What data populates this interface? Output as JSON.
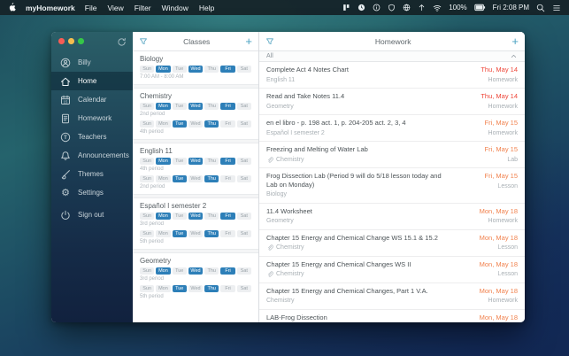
{
  "menu_bar": {
    "app_name": "myHomework",
    "menus": [
      "File",
      "View",
      "Filter",
      "Window",
      "Help"
    ],
    "status_icons": [
      "tiles-icon",
      "clock-icon",
      "info-icon",
      "shield-icon",
      "globe-icon",
      "arrow-up-icon",
      "wifi-icon"
    ],
    "battery_percent": "100%",
    "clock": "Fri 2:08 PM"
  },
  "sidebar": {
    "items": [
      {
        "label": "Billy",
        "icon": "user-icon",
        "selected": false
      },
      {
        "label": "Home",
        "icon": "home-icon",
        "selected": true
      },
      {
        "label": "Calendar",
        "icon": "calendar-icon",
        "selected": false
      },
      {
        "label": "Homework",
        "icon": "homework-icon",
        "selected": false
      },
      {
        "label": "Teachers",
        "icon": "teachers-icon",
        "selected": false
      },
      {
        "label": "Announcements",
        "icon": "bell-icon",
        "selected": false
      },
      {
        "label": "Themes",
        "icon": "brush-icon",
        "selected": false
      },
      {
        "label": "Settings",
        "icon": "gear-icon",
        "selected": false
      },
      {
        "label": "Sign out",
        "icon": "power-icon",
        "selected": false
      }
    ]
  },
  "classes_panel": {
    "title": "Classes",
    "day_labels": [
      "Sun",
      "Mon",
      "Tue",
      "Wed",
      "Thu",
      "Fri",
      "Sat"
    ],
    "classes": [
      {
        "name": "Biology",
        "schedules": [
          {
            "days": [
              "Mon",
              "Wed",
              "Fri"
            ],
            "label": "7:00 AM - 8:00 AM"
          }
        ]
      },
      {
        "name": "Chemistry",
        "schedules": [
          {
            "days": [
              "Mon",
              "Wed",
              "Fri"
            ],
            "label": "2nd period"
          },
          {
            "days": [
              "Tue",
              "Thu"
            ],
            "label": "4th period"
          }
        ]
      },
      {
        "name": "English 11",
        "schedules": [
          {
            "days": [
              "Mon",
              "Wed",
              "Fri"
            ],
            "label": "4th period"
          },
          {
            "days": [
              "Tue",
              "Thu"
            ],
            "label": "2nd period"
          }
        ]
      },
      {
        "name": "Español I semester 2",
        "schedules": [
          {
            "days": [
              "Mon",
              "Wed",
              "Fri"
            ],
            "label": "3rd period"
          },
          {
            "days": [
              "Tue",
              "Thu"
            ],
            "label": "5th period"
          }
        ]
      },
      {
        "name": "Geometry",
        "schedules": [
          {
            "days": [
              "Mon",
              "Wed",
              "Fri"
            ],
            "label": "3rd period"
          },
          {
            "days": [
              "Tue",
              "Thu"
            ],
            "label": "5th period"
          }
        ]
      }
    ]
  },
  "homework_panel": {
    "title": "Homework",
    "group_label": "All",
    "items": [
      {
        "title": "Complete Act 4 Notes Chart",
        "class": "English 11",
        "due": "Thu, May 14",
        "due_color": "#ee4639",
        "category": "Homework",
        "attachment": false
      },
      {
        "title": "Read and Take Notes 11.4",
        "class": "Geometry",
        "due": "Thu, May 14",
        "due_color": "#ee4639",
        "category": "Homework",
        "attachment": false
      },
      {
        "title": "en el libro - p. 198 act. 1, p. 204-205 act. 2, 3, 4",
        "class": "Español I semester 2",
        "due": "Fri, May 15",
        "due_color": "#f1824e",
        "category": "Homework",
        "attachment": false
      },
      {
        "title": "Freezing and Melting of Water Lab",
        "class": "Chemistry",
        "due": "Fri, May 15",
        "due_color": "#f1824e",
        "category": "Lab",
        "attachment": true
      },
      {
        "title": "Frog Dissection Lab (Period 9 will do 5/18 lesson today and Lab on Monday)",
        "class": "Biology",
        "due": "Fri, May 15",
        "due_color": "#f1824e",
        "category": "Lesson",
        "attachment": false
      },
      {
        "title": "11.4 Worksheet",
        "class": "Geometry",
        "due": "Mon, May 18",
        "due_color": "#f1824e",
        "category": "Homework",
        "attachment": false
      },
      {
        "title": "Chapter 15 Energy and Chemical Change WS 15.1 & 15.2",
        "class": "Chemistry",
        "due": "Mon, May 18",
        "due_color": "#f1824e",
        "category": "Lesson",
        "attachment": true
      },
      {
        "title": "Chapter 15 Energy and Chemical Changes WS II",
        "class": "Chemistry",
        "due": "Mon, May 18",
        "due_color": "#f1824e",
        "category": "Lesson",
        "attachment": true
      },
      {
        "title": "Chapter 15 Energy and Chemical Changes, Part 1 V.A.",
        "class": "Chemistry",
        "due": "Mon, May 18",
        "due_color": "#f1824e",
        "category": "Homework",
        "attachment": false
      },
      {
        "title": "LAB-Frog Dissection",
        "class": "",
        "due": "Mon, May 18",
        "due_color": "#f1824e",
        "category": "",
        "attachment": false
      }
    ]
  },
  "colors": {
    "accent_blue": "#2d7fb8",
    "due_red": "#ee4639",
    "due_orange": "#f1824e"
  }
}
